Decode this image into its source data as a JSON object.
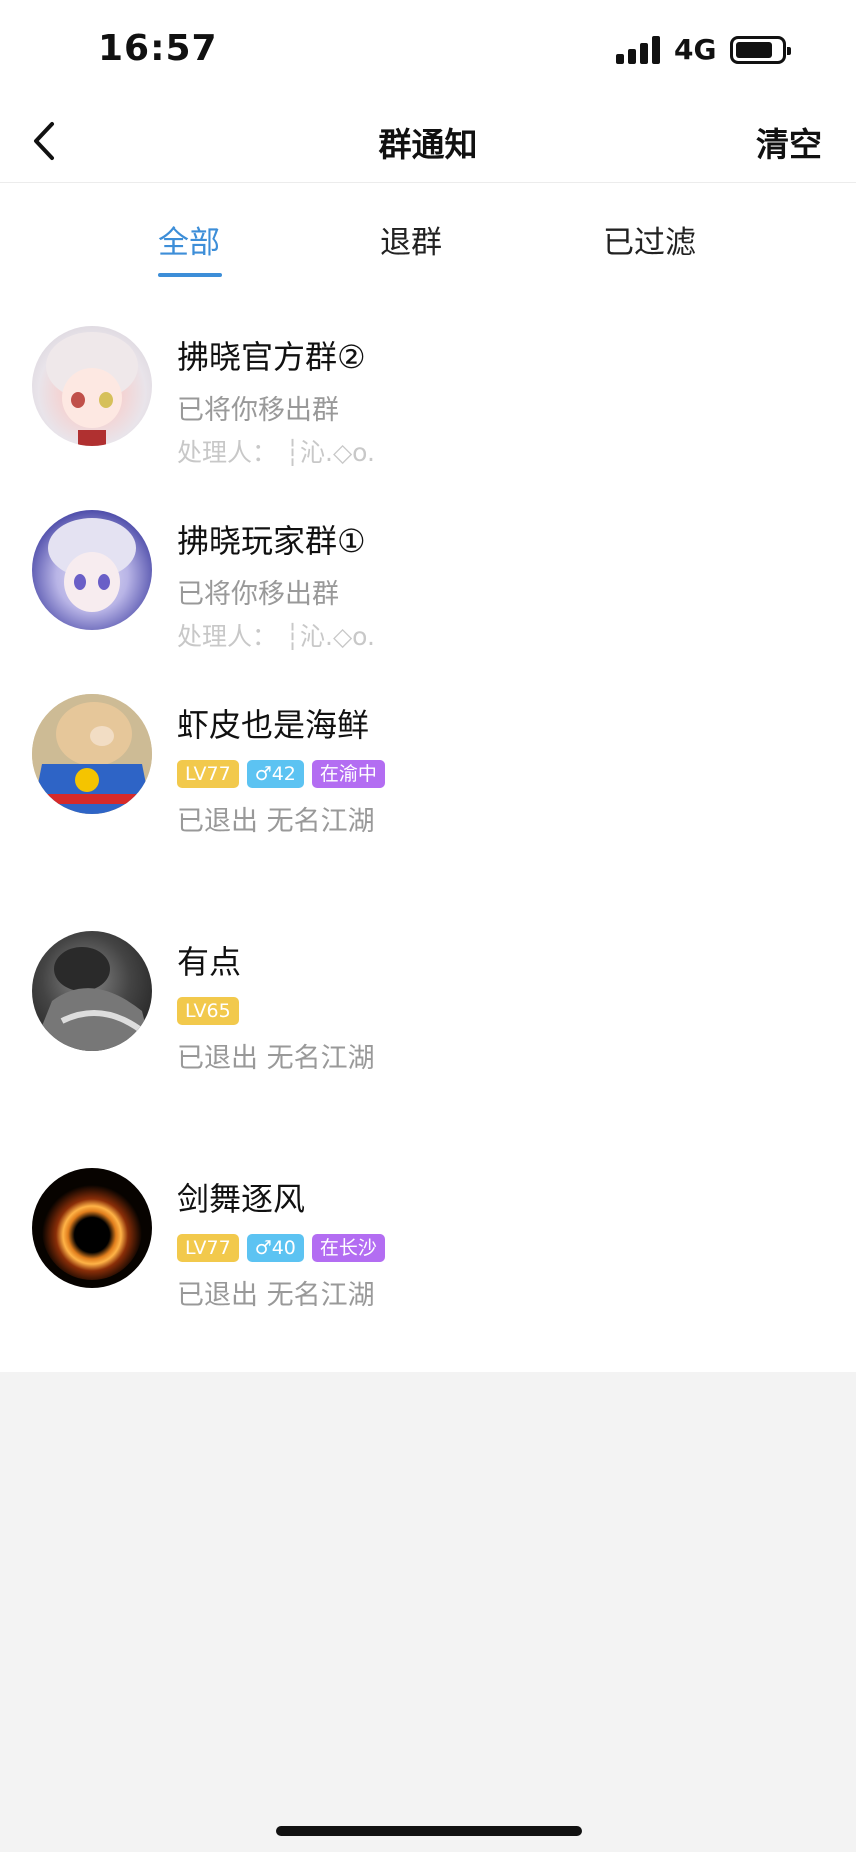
{
  "status_bar": {
    "time": "16:57",
    "network": "4G"
  },
  "navbar": {
    "title": "群通知",
    "clear_label": "清空"
  },
  "tabs": [
    {
      "label": "全部",
      "active": true
    },
    {
      "label": "退群",
      "active": false
    },
    {
      "label": "已过滤",
      "active": false
    }
  ],
  "notifications": [
    {
      "name": "拂晓官方群②",
      "status": "已将你移出群",
      "handler": "处理人：  ┆沁.◇o."
    },
    {
      "name": "拂晓玩家群①",
      "status": "已将你移出群",
      "handler": "处理人：  ┆沁.◇o."
    },
    {
      "name": "虾皮也是海鲜",
      "level": "LV77",
      "gender": "♂42",
      "location": "在渝中",
      "status": "已退出 无名江湖"
    },
    {
      "name": "有点",
      "level": "LV65",
      "status": "已退出 无名江湖"
    },
    {
      "name": "剑舞逐风",
      "level": "LV77",
      "gender": "♂40",
      "location": "在长沙",
      "status": "已退出 无名江湖"
    }
  ],
  "colors": {
    "accent": "#3d8ed8",
    "level_tag": "#f2c94c",
    "gender_tag": "#5cc3f2",
    "location_tag": "#b36df2"
  }
}
